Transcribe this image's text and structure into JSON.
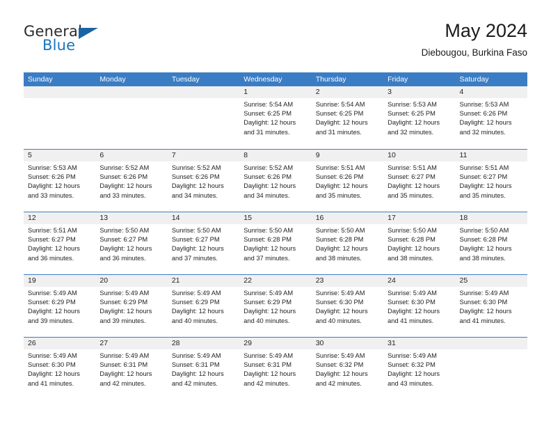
{
  "brand": {
    "name_top": "General",
    "name_bottom": "Blue",
    "accent_color": "#1b75bb"
  },
  "header": {
    "title": "May 2024",
    "subtitle": "Diebougou, Burkina Faso"
  },
  "calendar": {
    "header_color": "#3b7dc4",
    "weekdays": [
      "Sunday",
      "Monday",
      "Tuesday",
      "Wednesday",
      "Thursday",
      "Friday",
      "Saturday"
    ],
    "weeks": [
      [
        {
          "day": ""
        },
        {
          "day": ""
        },
        {
          "day": ""
        },
        {
          "day": "1",
          "sunrise": "Sunrise: 5:54 AM",
          "sunset": "Sunset: 6:25 PM",
          "daylight1": "Daylight: 12 hours",
          "daylight2": "and 31 minutes."
        },
        {
          "day": "2",
          "sunrise": "Sunrise: 5:54 AM",
          "sunset": "Sunset: 6:25 PM",
          "daylight1": "Daylight: 12 hours",
          "daylight2": "and 31 minutes."
        },
        {
          "day": "3",
          "sunrise": "Sunrise: 5:53 AM",
          "sunset": "Sunset: 6:25 PM",
          "daylight1": "Daylight: 12 hours",
          "daylight2": "and 32 minutes."
        },
        {
          "day": "4",
          "sunrise": "Sunrise: 5:53 AM",
          "sunset": "Sunset: 6:26 PM",
          "daylight1": "Daylight: 12 hours",
          "daylight2": "and 32 minutes."
        }
      ],
      [
        {
          "day": "5",
          "sunrise": "Sunrise: 5:53 AM",
          "sunset": "Sunset: 6:26 PM",
          "daylight1": "Daylight: 12 hours",
          "daylight2": "and 33 minutes."
        },
        {
          "day": "6",
          "sunrise": "Sunrise: 5:52 AM",
          "sunset": "Sunset: 6:26 PM",
          "daylight1": "Daylight: 12 hours",
          "daylight2": "and 33 minutes."
        },
        {
          "day": "7",
          "sunrise": "Sunrise: 5:52 AM",
          "sunset": "Sunset: 6:26 PM",
          "daylight1": "Daylight: 12 hours",
          "daylight2": "and 34 minutes."
        },
        {
          "day": "8",
          "sunrise": "Sunrise: 5:52 AM",
          "sunset": "Sunset: 6:26 PM",
          "daylight1": "Daylight: 12 hours",
          "daylight2": "and 34 minutes."
        },
        {
          "day": "9",
          "sunrise": "Sunrise: 5:51 AM",
          "sunset": "Sunset: 6:26 PM",
          "daylight1": "Daylight: 12 hours",
          "daylight2": "and 35 minutes."
        },
        {
          "day": "10",
          "sunrise": "Sunrise: 5:51 AM",
          "sunset": "Sunset: 6:27 PM",
          "daylight1": "Daylight: 12 hours",
          "daylight2": "and 35 minutes."
        },
        {
          "day": "11",
          "sunrise": "Sunrise: 5:51 AM",
          "sunset": "Sunset: 6:27 PM",
          "daylight1": "Daylight: 12 hours",
          "daylight2": "and 35 minutes."
        }
      ],
      [
        {
          "day": "12",
          "sunrise": "Sunrise: 5:51 AM",
          "sunset": "Sunset: 6:27 PM",
          "daylight1": "Daylight: 12 hours",
          "daylight2": "and 36 minutes."
        },
        {
          "day": "13",
          "sunrise": "Sunrise: 5:50 AM",
          "sunset": "Sunset: 6:27 PM",
          "daylight1": "Daylight: 12 hours",
          "daylight2": "and 36 minutes."
        },
        {
          "day": "14",
          "sunrise": "Sunrise: 5:50 AM",
          "sunset": "Sunset: 6:27 PM",
          "daylight1": "Daylight: 12 hours",
          "daylight2": "and 37 minutes."
        },
        {
          "day": "15",
          "sunrise": "Sunrise: 5:50 AM",
          "sunset": "Sunset: 6:28 PM",
          "daylight1": "Daylight: 12 hours",
          "daylight2": "and 37 minutes."
        },
        {
          "day": "16",
          "sunrise": "Sunrise: 5:50 AM",
          "sunset": "Sunset: 6:28 PM",
          "daylight1": "Daylight: 12 hours",
          "daylight2": "and 38 minutes."
        },
        {
          "day": "17",
          "sunrise": "Sunrise: 5:50 AM",
          "sunset": "Sunset: 6:28 PM",
          "daylight1": "Daylight: 12 hours",
          "daylight2": "and 38 minutes."
        },
        {
          "day": "18",
          "sunrise": "Sunrise: 5:50 AM",
          "sunset": "Sunset: 6:28 PM",
          "daylight1": "Daylight: 12 hours",
          "daylight2": "and 38 minutes."
        }
      ],
      [
        {
          "day": "19",
          "sunrise": "Sunrise: 5:49 AM",
          "sunset": "Sunset: 6:29 PM",
          "daylight1": "Daylight: 12 hours",
          "daylight2": "and 39 minutes."
        },
        {
          "day": "20",
          "sunrise": "Sunrise: 5:49 AM",
          "sunset": "Sunset: 6:29 PM",
          "daylight1": "Daylight: 12 hours",
          "daylight2": "and 39 minutes."
        },
        {
          "day": "21",
          "sunrise": "Sunrise: 5:49 AM",
          "sunset": "Sunset: 6:29 PM",
          "daylight1": "Daylight: 12 hours",
          "daylight2": "and 40 minutes."
        },
        {
          "day": "22",
          "sunrise": "Sunrise: 5:49 AM",
          "sunset": "Sunset: 6:29 PM",
          "daylight1": "Daylight: 12 hours",
          "daylight2": "and 40 minutes."
        },
        {
          "day": "23",
          "sunrise": "Sunrise: 5:49 AM",
          "sunset": "Sunset: 6:30 PM",
          "daylight1": "Daylight: 12 hours",
          "daylight2": "and 40 minutes."
        },
        {
          "day": "24",
          "sunrise": "Sunrise: 5:49 AM",
          "sunset": "Sunset: 6:30 PM",
          "daylight1": "Daylight: 12 hours",
          "daylight2": "and 41 minutes."
        },
        {
          "day": "25",
          "sunrise": "Sunrise: 5:49 AM",
          "sunset": "Sunset: 6:30 PM",
          "daylight1": "Daylight: 12 hours",
          "daylight2": "and 41 minutes."
        }
      ],
      [
        {
          "day": "26",
          "sunrise": "Sunrise: 5:49 AM",
          "sunset": "Sunset: 6:30 PM",
          "daylight1": "Daylight: 12 hours",
          "daylight2": "and 41 minutes."
        },
        {
          "day": "27",
          "sunrise": "Sunrise: 5:49 AM",
          "sunset": "Sunset: 6:31 PM",
          "daylight1": "Daylight: 12 hours",
          "daylight2": "and 42 minutes."
        },
        {
          "day": "28",
          "sunrise": "Sunrise: 5:49 AM",
          "sunset": "Sunset: 6:31 PM",
          "daylight1": "Daylight: 12 hours",
          "daylight2": "and 42 minutes."
        },
        {
          "day": "29",
          "sunrise": "Sunrise: 5:49 AM",
          "sunset": "Sunset: 6:31 PM",
          "daylight1": "Daylight: 12 hours",
          "daylight2": "and 42 minutes."
        },
        {
          "day": "30",
          "sunrise": "Sunrise: 5:49 AM",
          "sunset": "Sunset: 6:32 PM",
          "daylight1": "Daylight: 12 hours",
          "daylight2": "and 42 minutes."
        },
        {
          "day": "31",
          "sunrise": "Sunrise: 5:49 AM",
          "sunset": "Sunset: 6:32 PM",
          "daylight1": "Daylight: 12 hours",
          "daylight2": "and 43 minutes."
        },
        {
          "day": ""
        }
      ]
    ]
  }
}
